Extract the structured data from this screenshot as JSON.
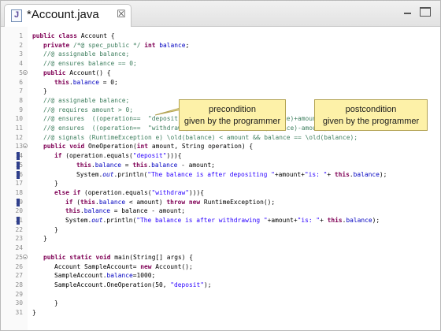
{
  "tab": {
    "title": "*Account.java",
    "close_glyph": "☒"
  },
  "window_controls": {
    "minimize": "minimize",
    "maximize": "maximize"
  },
  "callouts": {
    "precondition": [
      "precondition",
      "given by the programmer"
    ],
    "postcondition": [
      "postcondition",
      "given by the programmer"
    ],
    "color": "#fdf1a8"
  },
  "colors": {
    "keyword": "#7f0055",
    "comment": "#3f7f5f",
    "string": "#2a00ff",
    "field": "#0000c0",
    "line_number": "#8c8c8c",
    "change_marker": "#2f3f8c"
  },
  "code_lines": [
    {
      "n": "1",
      "indent": 0,
      "tokens": [
        [
          "kw",
          "public "
        ],
        [
          "kw",
          "class "
        ],
        [
          "",
          "Account {"
        ]
      ]
    },
    {
      "n": "2",
      "indent": 1,
      "tokens": [
        [
          "kw",
          "private "
        ],
        [
          "cm",
          "/*@ spec_public */ "
        ],
        [
          "kw",
          "int "
        ],
        [
          "fld",
          "balance"
        ],
        [
          "",
          ";"
        ]
      ]
    },
    {
      "n": "3",
      "indent": 1,
      "tokens": [
        [
          "cm",
          "//@ assignable balance;"
        ]
      ]
    },
    {
      "n": "4",
      "indent": 1,
      "tokens": [
        [
          "cm",
          "//@ ensures balance == 0;"
        ]
      ]
    },
    {
      "n": "5",
      "indent": 1,
      "fold": true,
      "tokens": [
        [
          "kw",
          "public "
        ],
        [
          "",
          "Account() {"
        ]
      ]
    },
    {
      "n": "6",
      "indent": 2,
      "tokens": [
        [
          "kw",
          "this"
        ],
        [
          "",
          "."
        ],
        [
          "fld",
          "balance"
        ],
        [
          "",
          " = 0;"
        ]
      ]
    },
    {
      "n": "7",
      "indent": 1,
      "tokens": [
        [
          "",
          "}"
        ]
      ]
    },
    {
      "n": "8",
      "indent": 1,
      "tokens": [
        [
          "cm",
          "//@ assignable balance;"
        ]
      ]
    },
    {
      "n": "9",
      "indent": 1,
      "tokens": [
        [
          "cm",
          "//@ requires amount > 0;"
        ]
      ]
    },
    {
      "n": "10",
      "indent": 1,
      "tokens": [
        [
          "cm",
          "//@ ensures  ((operation==  \"deposit\") ==> balance == \\old(balance)+amount);"
        ]
      ]
    },
    {
      "n": "11",
      "indent": 1,
      "tokens": [
        [
          "cm",
          "//@ ensures  ((operation==  \"withdraw\") ==> balance == \\old(balance)-amount);"
        ]
      ]
    },
    {
      "n": "12",
      "indent": 1,
      "tokens": [
        [
          "cm",
          "//@ signals (RuntimeException e) \\old(balance) < amount && balance == \\old(balance);"
        ]
      ]
    },
    {
      "n": "13",
      "indent": 1,
      "fold": true,
      "tokens": [
        [
          "kw",
          "public "
        ],
        [
          "kw",
          "void "
        ],
        [
          "",
          "OneOperation("
        ],
        [
          "kw",
          "int "
        ],
        [
          "",
          "amount, String operation) {"
        ]
      ]
    },
    {
      "n": "14",
      "indent": 2,
      "marker": true,
      "tokens": [
        [
          "kw",
          "if "
        ],
        [
          "",
          "(operation.equals("
        ],
        [
          "str",
          "\"deposit\""
        ],
        [
          "",
          "))){"
        ]
      ]
    },
    {
      "n": "15",
      "indent": 4,
      "marker": true,
      "tokens": [
        [
          "kw",
          "this"
        ],
        [
          "",
          "."
        ],
        [
          "fld",
          "balance"
        ],
        [
          "",
          " = "
        ],
        [
          "kw",
          "this"
        ],
        [
          "",
          "."
        ],
        [
          "fld",
          "balance"
        ],
        [
          "",
          " - amount;"
        ]
      ]
    },
    {
      "n": "16",
      "indent": 4,
      "marker": true,
      "tokens": [
        [
          "",
          "System."
        ],
        [
          "sfld",
          "out"
        ],
        [
          "",
          ".println("
        ],
        [
          "str",
          "\"The balance is after depositing \""
        ],
        [
          "",
          "+amount+"
        ],
        [
          "str",
          "\"is: \""
        ],
        [
          "",
          "+ "
        ],
        [
          "kw",
          "this"
        ],
        [
          "",
          "."
        ],
        [
          "fld",
          "balance"
        ],
        [
          "",
          ");"
        ]
      ]
    },
    {
      "n": "17",
      "indent": 2,
      "tokens": [
        [
          "",
          "}"
        ]
      ]
    },
    {
      "n": "18",
      "indent": 2,
      "tokens": [
        [
          "kw",
          "else if "
        ],
        [
          "",
          "(operation.equals("
        ],
        [
          "str",
          "\"withdraw\""
        ],
        [
          "",
          "))){"
        ]
      ]
    },
    {
      "n": "19",
      "indent": 3,
      "marker": true,
      "tokens": [
        [
          "kw",
          "if "
        ],
        [
          "",
          "("
        ],
        [
          "kw",
          "this"
        ],
        [
          "",
          "."
        ],
        [
          "fld",
          "balance"
        ],
        [
          "",
          " < amount) "
        ],
        [
          "kw",
          "throw new "
        ],
        [
          "",
          "RuntimeException();"
        ]
      ]
    },
    {
      "n": "20",
      "indent": 3,
      "tokens": [
        [
          "kw",
          "this"
        ],
        [
          "",
          "."
        ],
        [
          "fld",
          "balance"
        ],
        [
          "",
          " = balance - amount;"
        ]
      ]
    },
    {
      "n": "21",
      "indent": 3,
      "marker": true,
      "tokens": [
        [
          "",
          "System."
        ],
        [
          "sfld",
          "out"
        ],
        [
          "",
          ".println("
        ],
        [
          "str",
          "\"The balance is after withdrawing \""
        ],
        [
          "",
          "+amount+"
        ],
        [
          "str",
          "\"is: \""
        ],
        [
          "",
          "+ "
        ],
        [
          "kw",
          "this"
        ],
        [
          "",
          "."
        ],
        [
          "fld",
          "balance"
        ],
        [
          "",
          ");"
        ]
      ]
    },
    {
      "n": "22",
      "indent": 2,
      "tokens": [
        [
          "",
          "}"
        ]
      ]
    },
    {
      "n": "23",
      "indent": 1,
      "tokens": [
        [
          "",
          "}"
        ]
      ]
    },
    {
      "n": "24",
      "indent": 0,
      "tokens": []
    },
    {
      "n": "25",
      "indent": 1,
      "fold": true,
      "tokens": [
        [
          "kw",
          "public "
        ],
        [
          "kw",
          "static "
        ],
        [
          "kw",
          "void "
        ],
        [
          "",
          "main(String[] args) {"
        ]
      ]
    },
    {
      "n": "26",
      "indent": 2,
      "tokens": [
        [
          "",
          "Account SampleAccount= "
        ],
        [
          "kw",
          "new "
        ],
        [
          "",
          "Account();"
        ]
      ]
    },
    {
      "n": "27",
      "indent": 2,
      "tokens": [
        [
          "",
          "SampleAccount."
        ],
        [
          "fld",
          "balance"
        ],
        [
          "",
          "=1000;"
        ]
      ]
    },
    {
      "n": "28",
      "indent": 2,
      "tokens": [
        [
          "",
          "SampleAccount.OneOperation(50, "
        ],
        [
          "str",
          "\"deposit\""
        ],
        [
          "",
          ");"
        ]
      ]
    },
    {
      "n": "29",
      "indent": 0,
      "tokens": []
    },
    {
      "n": "30",
      "indent": 2,
      "tokens": [
        [
          "",
          "}"
        ]
      ]
    },
    {
      "n": "31",
      "indent": 0,
      "tokens": [
        [
          "",
          "}"
        ]
      ]
    }
  ]
}
